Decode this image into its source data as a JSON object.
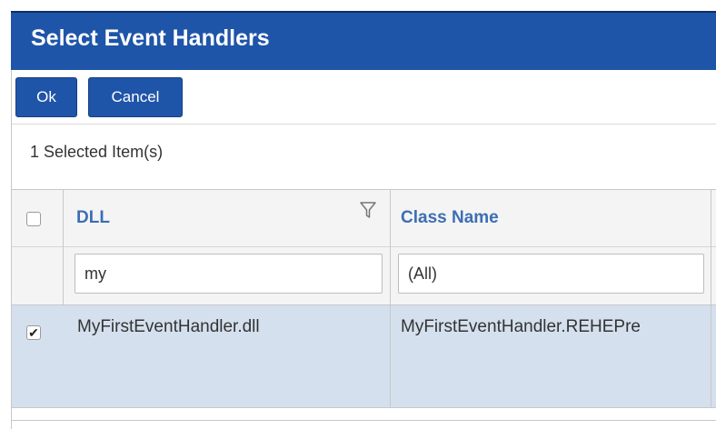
{
  "dialog": {
    "title": "Select Event Handlers"
  },
  "toolbar": {
    "ok_label": "Ok",
    "cancel_label": "Cancel"
  },
  "selection": {
    "status": "1 Selected Item(s)"
  },
  "grid": {
    "columns": [
      {
        "label": "DLL"
      },
      {
        "label": "Class Name"
      }
    ],
    "filters": {
      "dll_value": "my",
      "class_value": "(All)"
    },
    "rows": [
      {
        "checked": true,
        "dll": "MyFirstEventHandler.dll",
        "class_name": "MyFirstEventHandler.REHEPre"
      }
    ]
  },
  "colors": {
    "title_bar": "#1f55a8",
    "button": "#1f55a8",
    "header_text": "#3c6eb4",
    "selected_row": "#d4e0ee"
  }
}
